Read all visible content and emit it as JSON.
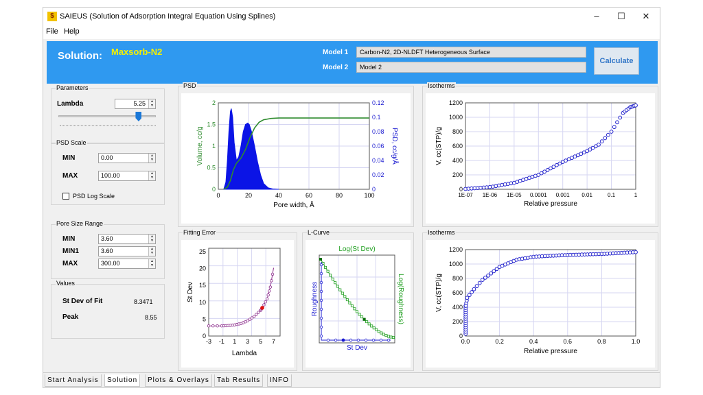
{
  "window": {
    "title": "SAIEUS (Solution of Adsorption Integral Equation Using Splines)",
    "min": "–",
    "max": "☐",
    "close": "✕"
  },
  "menu": [
    "File",
    "Help"
  ],
  "banner": {
    "solution_label": "Solution:",
    "solution_name": "Maxsorb-N2",
    "model1_label": "Model 1",
    "model1_value": "Carbon-N2, 2D-NLDFT Heterogeneous Surface",
    "model2_label": "Model 2",
    "model2_value": "Model 2",
    "calculate": "Calculate"
  },
  "parameters": {
    "title": "Parameters",
    "lambda_label": "Lambda",
    "lambda_value": "5.25",
    "slider_fraction": 0.82
  },
  "psd_scale": {
    "title": "PSD Scale",
    "min_label": "MIN",
    "min_value": "0.00",
    "max_label": "MAX",
    "max_value": "100.00",
    "log_label": "PSD Log Scale"
  },
  "pore_range": {
    "title": "Pore Size Range",
    "min_label": "MIN",
    "min_value": "3.60",
    "min1_label": "MIN1",
    "min1_value": "3.60",
    "max_label": "MAX",
    "max_value": "300.00"
  },
  "values": {
    "title": "Values",
    "stdev_label": "St Dev of Fit",
    "stdev_value": "8.3471",
    "peak_label": "Peak",
    "peak_value": "8.55"
  },
  "panels": {
    "psd": "PSD",
    "isotherms": "Isotherms",
    "fitting": "Fitting Error",
    "lcurve": "L-Curve",
    "isotherms2": "Isotherms"
  },
  "tabs": [
    "Start Analysis",
    "Solution",
    "Plots & Overlays",
    "Tab Results",
    "INFO"
  ],
  "active_tab": "Solution",
  "chart_data": [
    {
      "type": "area",
      "name": "psd",
      "xlabel": "Pore width, Å",
      "ylabel_left": "Volume, cc/g",
      "ylabel_right": "PSD, cc/g/Å",
      "x_ticks": [
        "0",
        "20",
        "40",
        "60",
        "80",
        "100"
      ],
      "yleft_ticks": [
        "0",
        "0.5",
        "1",
        "1.5",
        "2"
      ],
      "yright_ticks": [
        "0",
        "0.02",
        "0.04",
        "0.06",
        "0.08",
        "0.1",
        "0.12"
      ],
      "xlim": [
        0,
        100
      ],
      "ylim_left": [
        0,
        2
      ],
      "ylim_right": [
        0,
        0.12
      ],
      "psd": {
        "x": [
          3.6,
          5,
          6,
          7,
          8,
          8.6,
          9.5,
          10.5,
          12,
          13.5,
          15,
          16.5,
          18,
          19.5,
          20.5,
          22,
          24,
          26,
          28,
          30,
          33,
          36,
          40
        ],
        "y": [
          0,
          0.01,
          0.04,
          0.08,
          0.108,
          0.112,
          0.1,
          0.065,
          0.04,
          0.045,
          0.06,
          0.08,
          0.09,
          0.092,
          0.09,
          0.08,
          0.06,
          0.038,
          0.02,
          0.008,
          0.002,
          0.0005,
          0
        ]
      },
      "cumulative": {
        "x": [
          3.6,
          6,
          8,
          10,
          12,
          15,
          18,
          21,
          24,
          27,
          30,
          35,
          40,
          60,
          100
        ],
        "y": [
          0,
          0.05,
          0.2,
          0.45,
          0.6,
          0.72,
          0.92,
          1.2,
          1.42,
          1.55,
          1.61,
          1.64,
          1.65,
          1.65,
          1.65
        ]
      }
    },
    {
      "type": "scatter",
      "name": "isotherm-log",
      "xlabel": "Relative pressure",
      "ylabel": "V, cc(STP)/g",
      "x_scale": "log",
      "x_ticks": [
        "1E-07",
        "1E-06",
        "1E-05",
        "0.0001",
        "0.001",
        "0.01",
        "0.1",
        "1"
      ],
      "y_ticks": [
        "0",
        "200",
        "400",
        "600",
        "800",
        "1000",
        "1200"
      ],
      "xlim": [
        1e-07,
        1
      ],
      "ylim": [
        0,
        1200
      ],
      "x": [
        1e-07,
        1e-06,
        1e-05,
        0.0001,
        0.001,
        0.01,
        0.03,
        0.1,
        0.3,
        0.6,
        1
      ],
      "y": [
        5,
        30,
        90,
        200,
        380,
        530,
        620,
        800,
        1060,
        1140,
        1165
      ]
    },
    {
      "type": "line",
      "name": "fitting-error",
      "xlabel": "Lambda",
      "ylabel": "St Dev",
      "x_ticks": [
        "-3",
        "-1",
        "1",
        "3",
        "5",
        "7"
      ],
      "y_ticks": [
        "0",
        "5",
        "10",
        "15",
        "20",
        "25"
      ],
      "xlim": [
        -3,
        8
      ],
      "ylim": [
        0,
        26
      ],
      "x": [
        -3,
        -1,
        0,
        1,
        2,
        3,
        4,
        5,
        5.25,
        6,
        6.5,
        7
      ],
      "y": [
        3,
        3,
        3.1,
        3.3,
        3.7,
        4.5,
        5.8,
        7.6,
        8.3471,
        11,
        14.5,
        20.2
      ],
      "selected": {
        "x": 5.25,
        "y": 8.3471
      }
    },
    {
      "type": "line",
      "name": "l-curve",
      "title": "Log(St Dev)",
      "xlabel": "St Dev",
      "ylabel_left": "Roughness",
      "ylabel_right": "Log(Roughness)"
    },
    {
      "type": "scatter",
      "name": "isotherm-linear",
      "xlabel": "Relative pressure",
      "ylabel": "V, cc(STP)/g",
      "x_ticks": [
        "0.0",
        "0.2",
        "0.4",
        "0.6",
        "0.8",
        "1.0"
      ],
      "y_ticks": [
        "0",
        "200",
        "400",
        "600",
        "800",
        "1000",
        "1200"
      ],
      "xlim": [
        0,
        1
      ],
      "ylim": [
        0,
        1200
      ],
      "x": [
        0,
        0.002,
        0.01,
        0.05,
        0.1,
        0.2,
        0.3,
        0.4,
        0.5,
        0.6,
        0.8,
        1.0
      ],
      "y": [
        0,
        420,
        530,
        650,
        780,
        960,
        1060,
        1100,
        1115,
        1125,
        1140,
        1165
      ]
    }
  ]
}
